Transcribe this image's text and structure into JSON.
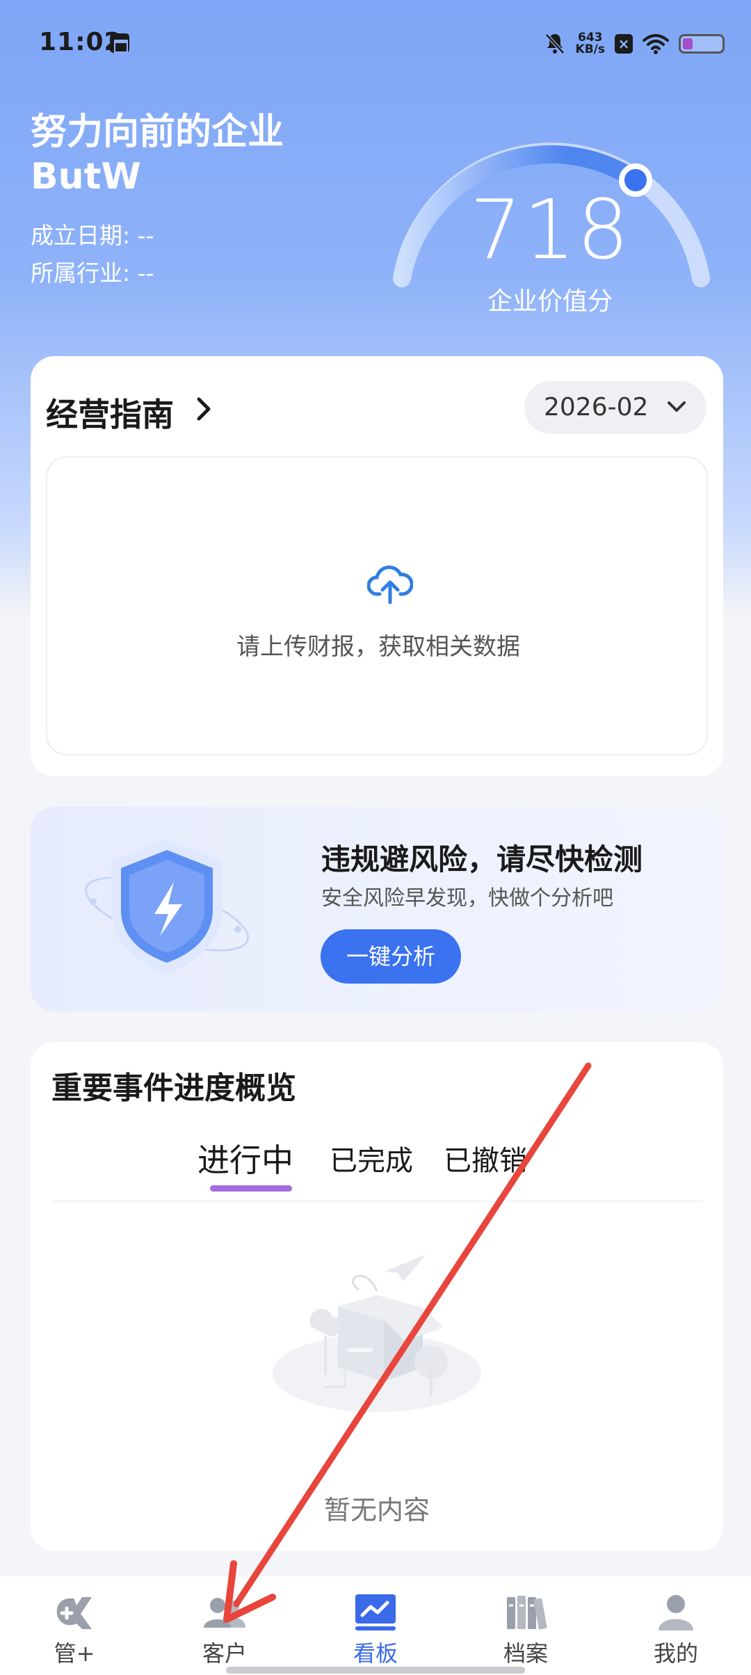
{
  "status_bar": {
    "time": "11:02",
    "net_speed_value": "643",
    "net_speed_unit": "KB/s",
    "icons": [
      "app-notification-icon",
      "bell-muted-icon",
      "x-app-icon",
      "wifi-icon",
      "battery-icon"
    ]
  },
  "company": {
    "name_line1": "努力向前的企业",
    "name_line2": "ButW",
    "founded_label": "成立日期:",
    "founded_value": "--",
    "industry_label": "所属行业:",
    "industry_value": "--"
  },
  "score": {
    "value": "718",
    "label": "企业价值分"
  },
  "guide": {
    "title": "经营指南",
    "date": "2026-02",
    "upload_text": "请上传财报，获取相关数据"
  },
  "risk": {
    "title": "违规避风险，请尽快检测",
    "subtitle": "安全风险早发现，快做个分析吧",
    "button": "一键分析"
  },
  "events": {
    "title": "重要事件进度概览",
    "tabs": [
      "进行中",
      "已完成",
      "已撤销"
    ],
    "active_tab": "进行中",
    "empty_text": "暂无内容"
  },
  "bottom_nav": {
    "items": [
      {
        "label": "管+",
        "icon": "guan-plus-icon"
      },
      {
        "label": "客户",
        "icon": "customers-icon"
      },
      {
        "label": "看板",
        "icon": "dashboard-icon"
      },
      {
        "label": "档案",
        "icon": "archive-icon"
      },
      {
        "label": "我的",
        "icon": "profile-icon"
      }
    ],
    "active": "看板"
  },
  "colors": {
    "accent": "#3a72f0",
    "hero_top": "#7ea6f6",
    "tab_underline": "#a46ce0",
    "annotation_arrow": "#e8453c"
  }
}
